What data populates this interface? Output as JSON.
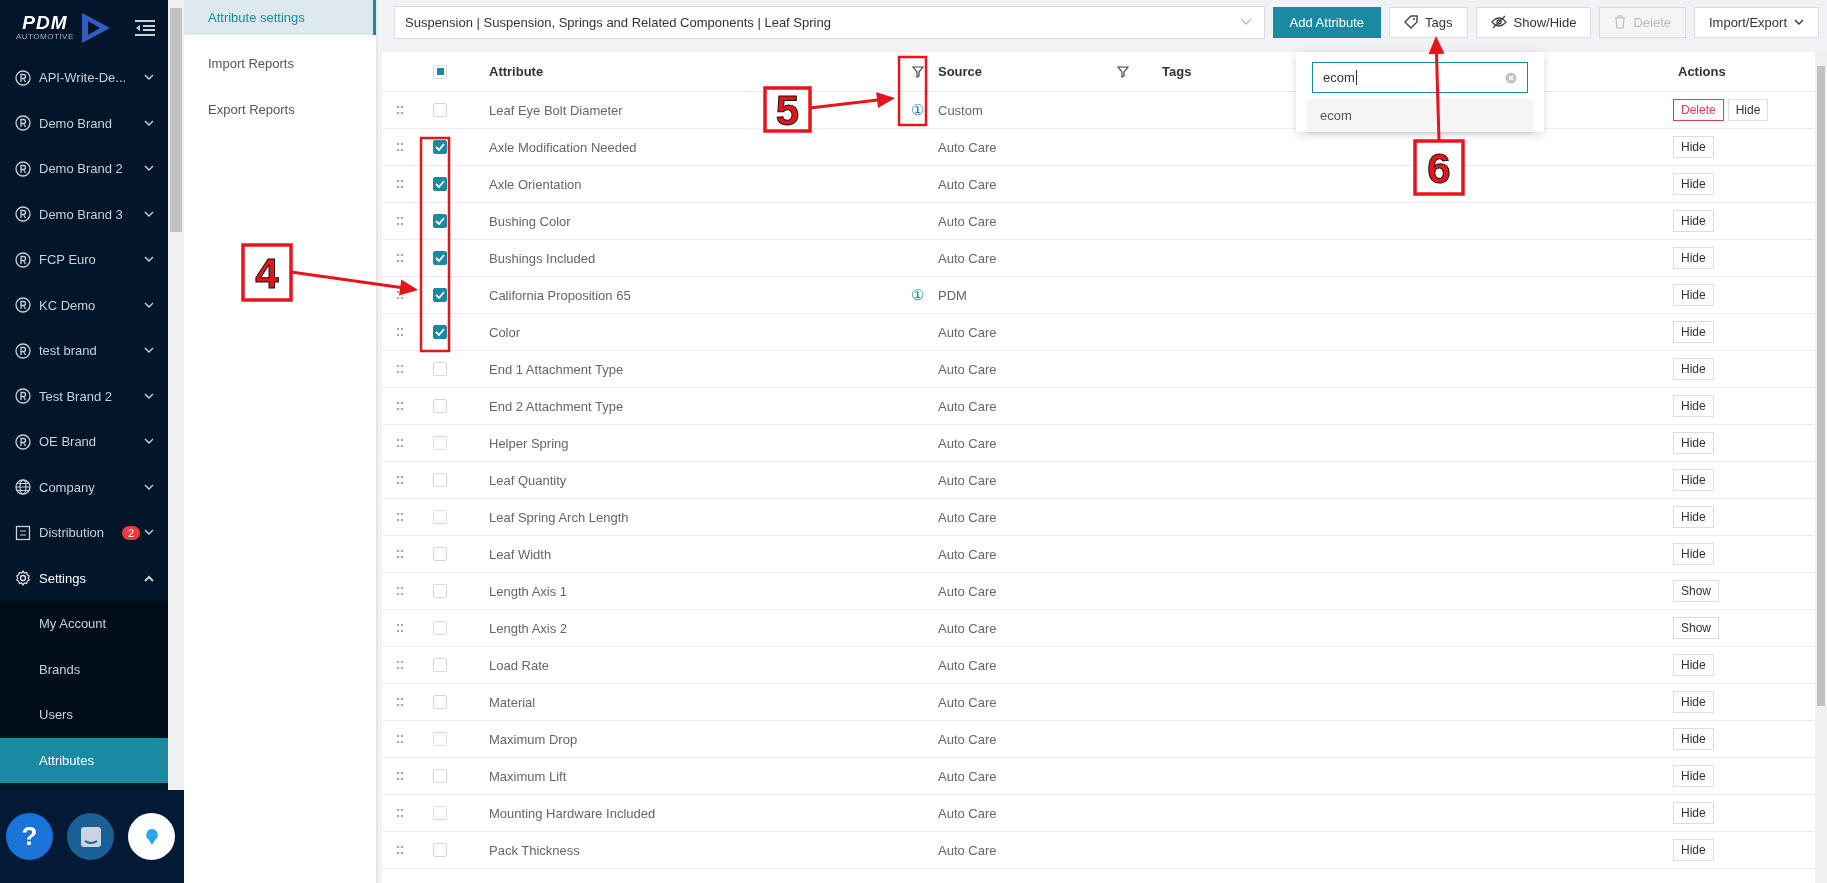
{
  "logo": {
    "name": "PDM",
    "tagline": "AUTOMOTIVE"
  },
  "sidebar": {
    "items": [
      {
        "label": "API-Write-De...",
        "kind": "brand",
        "expanded": false
      },
      {
        "label": "Demo Brand",
        "kind": "brand",
        "expanded": false
      },
      {
        "label": "Demo Brand 2",
        "kind": "brand",
        "expanded": false
      },
      {
        "label": "Demo Brand 3",
        "kind": "brand",
        "expanded": false
      },
      {
        "label": "FCP Euro",
        "kind": "brand",
        "expanded": false
      },
      {
        "label": "KC Demo",
        "kind": "brand",
        "expanded": false
      },
      {
        "label": "test brand",
        "kind": "brand",
        "expanded": false
      },
      {
        "label": "Test Brand 2",
        "kind": "brand",
        "expanded": false
      },
      {
        "label": "OE Brand",
        "kind": "brand",
        "expanded": false
      },
      {
        "label": "Company",
        "kind": "globe",
        "expanded": false
      },
      {
        "label": "Distribution",
        "kind": "distribution",
        "badge": "2",
        "expanded": false
      },
      {
        "label": "Settings",
        "kind": "settings",
        "expanded": true,
        "children": [
          {
            "label": "My Account",
            "selected": false
          },
          {
            "label": "Brands",
            "selected": false
          },
          {
            "label": "Users",
            "selected": false
          },
          {
            "label": "Attributes",
            "selected": true
          }
        ]
      }
    ]
  },
  "footer": {
    "help_label": "?"
  },
  "subnav": [
    {
      "label": "Attribute settings",
      "selected": true
    },
    {
      "label": "Import Reports",
      "selected": false
    },
    {
      "label": "Export Reports",
      "selected": false
    }
  ],
  "toolbar": {
    "category": "Suspension | Suspension, Springs and Related Components | Leaf Spring",
    "buttons": [
      {
        "label": "Add Attribute",
        "kind": "primary",
        "disabled": false
      },
      {
        "label": "Tags",
        "kind": "tags",
        "disabled": false
      },
      {
        "label": "Show/Hide",
        "kind": "showhide",
        "disabled": false
      },
      {
        "label": "Delete",
        "kind": "delete",
        "disabled": true
      },
      {
        "label": "Import/Export",
        "kind": "dropdown",
        "disabled": false
      }
    ]
  },
  "tags_dropdown": {
    "value": "ecom",
    "options": [
      "ecom"
    ]
  },
  "table": {
    "select_all": {
      "indeterminate": true
    },
    "columns": [
      {
        "label": "Attribute",
        "filter": true
      },
      {
        "label": "Source",
        "filter": true
      },
      {
        "label": "Tags"
      },
      {
        "label": "Actions"
      }
    ],
    "rows": [
      {
        "attribute": "Leaf Eye Bolt Diameter",
        "note": "①",
        "source": "Custom",
        "checked": false,
        "actions": [
          {
            "label": "Delete",
            "kind": "danger"
          },
          {
            "label": "Hide",
            "kind": "default"
          }
        ]
      },
      {
        "attribute": "Axle Modification Needed",
        "source": "Auto Care",
        "checked": true,
        "actions": [
          {
            "label": "Hide",
            "kind": "default"
          }
        ]
      },
      {
        "attribute": "Axle Orientation",
        "source": "Auto Care",
        "checked": true,
        "actions": [
          {
            "label": "Hide",
            "kind": "default"
          }
        ]
      },
      {
        "attribute": "Bushing Color",
        "source": "Auto Care",
        "checked": true,
        "actions": [
          {
            "label": "Hide",
            "kind": "default"
          }
        ]
      },
      {
        "attribute": "Bushings Included",
        "source": "Auto Care",
        "checked": true,
        "actions": [
          {
            "label": "Hide",
            "kind": "default"
          }
        ]
      },
      {
        "attribute": "California Proposition 65",
        "note": "①",
        "source": "PDM",
        "checked": true,
        "actions": [
          {
            "label": "Hide",
            "kind": "default"
          }
        ]
      },
      {
        "attribute": "Color",
        "source": "Auto Care",
        "checked": true,
        "actions": [
          {
            "label": "Hide",
            "kind": "default"
          }
        ]
      },
      {
        "attribute": "End 1 Attachment Type",
        "source": "Auto Care",
        "checked": false,
        "actions": [
          {
            "label": "Hide",
            "kind": "default"
          }
        ]
      },
      {
        "attribute": "End 2 Attachment Type",
        "source": "Auto Care",
        "checked": false,
        "actions": [
          {
            "label": "Hide",
            "kind": "default"
          }
        ]
      },
      {
        "attribute": "Helper Spring",
        "source": "Auto Care",
        "checked": false,
        "actions": [
          {
            "label": "Hide",
            "kind": "default"
          }
        ]
      },
      {
        "attribute": "Leaf Quantity",
        "source": "Auto Care",
        "checked": false,
        "actions": [
          {
            "label": "Hide",
            "kind": "default"
          }
        ]
      },
      {
        "attribute": "Leaf Spring Arch Length",
        "source": "Auto Care",
        "checked": false,
        "actions": [
          {
            "label": "Hide",
            "kind": "default"
          }
        ]
      },
      {
        "attribute": "Leaf Width",
        "source": "Auto Care",
        "checked": false,
        "actions": [
          {
            "label": "Hide",
            "kind": "default"
          }
        ]
      },
      {
        "attribute": "Length Axis 1",
        "source": "Auto Care",
        "checked": false,
        "actions": [
          {
            "label": "Show",
            "kind": "default"
          }
        ]
      },
      {
        "attribute": "Length Axis 2",
        "source": "Auto Care",
        "checked": false,
        "actions": [
          {
            "label": "Show",
            "kind": "default"
          }
        ]
      },
      {
        "attribute": "Load Rate",
        "source": "Auto Care",
        "checked": false,
        "actions": [
          {
            "label": "Hide",
            "kind": "default"
          }
        ]
      },
      {
        "attribute": "Material",
        "source": "Auto Care",
        "checked": false,
        "actions": [
          {
            "label": "Hide",
            "kind": "default"
          }
        ]
      },
      {
        "attribute": "Maximum Drop",
        "source": "Auto Care",
        "checked": false,
        "actions": [
          {
            "label": "Hide",
            "kind": "default"
          }
        ]
      },
      {
        "attribute": "Maximum Lift",
        "source": "Auto Care",
        "checked": false,
        "actions": [
          {
            "label": "Hide",
            "kind": "default"
          }
        ]
      },
      {
        "attribute": "Mounting Hardware Included",
        "source": "Auto Care",
        "checked": false,
        "actions": [
          {
            "label": "Hide",
            "kind": "default"
          }
        ]
      },
      {
        "attribute": "Pack Thickness",
        "source": "Auto Care",
        "checked": false,
        "actions": [
          {
            "label": "Hide",
            "kind": "default"
          }
        ]
      }
    ]
  },
  "callouts": [
    {
      "label": "4"
    },
    {
      "label": "5"
    },
    {
      "label": "6"
    }
  ]
}
